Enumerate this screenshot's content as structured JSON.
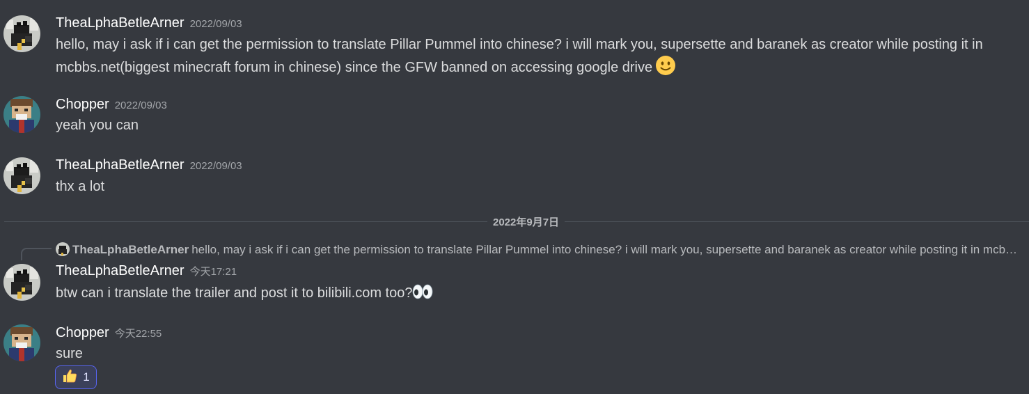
{
  "messages": [
    {
      "author": "TheaLphaBetleArner",
      "timestamp": "2022/09/03",
      "text": "hello, may i ask if i can get the permission to translate Pillar Pummel into chinese? i will mark you, supersette and baranek as creator while posting it in mcbbs.net(biggest minecraft forum in chinese) since the GFW banned on accessing google drive",
      "emoji": "slightly-smiling-face"
    },
    {
      "author": "Chopper",
      "timestamp": "2022/09/03",
      "text": "yeah you can"
    },
    {
      "author": "TheaLphaBetleArner",
      "timestamp": "2022/09/03",
      "text": "thx a lot"
    },
    {
      "reply": {
        "author": "TheaLphaBetleArner",
        "text": "hello, may i ask if i can get the permission to translate Pillar Pummel into chinese? i will mark you, supersette and baranek as creator while posting it in mcbbs.net(biggest minecraft forum in chinese) since the GFW banned on accessing google drive"
      },
      "author": "TheaLphaBetleArner",
      "timestamp": "今天17:21",
      "text": "btw can i translate the trailer and post it to bilibili.com too?",
      "emoji": "eyes"
    },
    {
      "author": "Chopper",
      "timestamp": "今天22:55",
      "text": "sure",
      "reaction": {
        "emoji": "thumbs-up",
        "count": "1"
      }
    }
  ],
  "date_divider": "2022年9月7日",
  "colors": {
    "background": "#36393f",
    "username": "#ffffff",
    "message_text": "#dcddde",
    "timestamp": "#a3a6aa",
    "divider": "#4f545c",
    "reaction_border": "#5865f2",
    "reaction_bg": "#3b405a"
  }
}
